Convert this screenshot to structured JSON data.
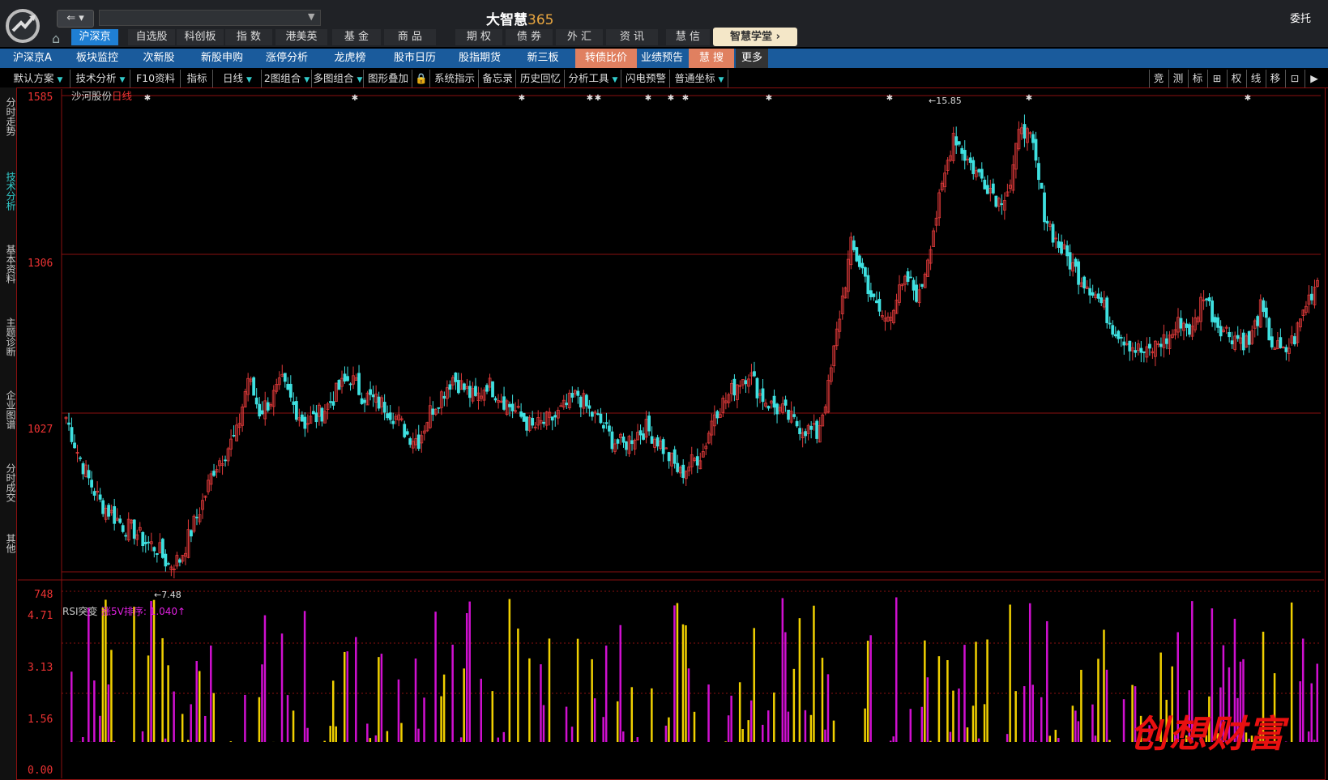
{
  "app": {
    "title_main": "大智慧",
    "title_num": "365",
    "back_label": "⇐ ▾",
    "entrust_label": "委托"
  },
  "top_nav": [
    {
      "label": "沪深京"
    },
    {
      "label": "自选股"
    },
    {
      "label": "科创板"
    },
    {
      "label": "指 数"
    },
    {
      "label": "港美英"
    },
    {
      "label": "基 金"
    },
    {
      "label": "商 品"
    },
    {
      "label": "期 权"
    },
    {
      "label": "债 券"
    },
    {
      "label": "外 汇"
    },
    {
      "label": "资 讯"
    },
    {
      "label": "慧 信"
    }
  ],
  "academy_label": "智慧学堂 ›",
  "nav2": [
    {
      "label": "沪深京A"
    },
    {
      "label": "板块监控"
    },
    {
      "label": "次新股"
    },
    {
      "label": "新股申购"
    },
    {
      "label": "涨停分析"
    },
    {
      "label": "龙虎榜"
    },
    {
      "label": "股市日历"
    },
    {
      "label": "股指期货"
    },
    {
      "label": "新三板"
    },
    {
      "label": "转债比价"
    },
    {
      "label": "业绩预告"
    },
    {
      "label": "慧 搜"
    },
    {
      "label": "更多"
    }
  ],
  "toolbar": [
    {
      "label": "默认方案"
    },
    {
      "label": "技术分析"
    },
    {
      "label": "F10资料"
    },
    {
      "label": "指标"
    },
    {
      "label": "日线"
    },
    {
      "label": "2图组合"
    },
    {
      "label": "多图组合"
    },
    {
      "label": "图形叠加"
    },
    {
      "label": "系统指示"
    },
    {
      "label": "备忘录"
    },
    {
      "label": "历史回忆"
    },
    {
      "label": "分析工具"
    },
    {
      "label": "闪电预警"
    },
    {
      "label": "普通坐标"
    }
  ],
  "toolbar_right": [
    "竞",
    "测",
    "标",
    "⊞",
    "权",
    "线",
    "移",
    "⊡",
    "▶"
  ],
  "sidebar": [
    {
      "label": "分时走势"
    },
    {
      "label": "技术分析"
    },
    {
      "label": "基本资料"
    },
    {
      "label": "主题诊断"
    },
    {
      "label": "企业图谱"
    },
    {
      "label": "分时成交"
    },
    {
      "label": "其他"
    }
  ],
  "stock": {
    "name": "沙河股份",
    "period": "日线"
  },
  "price_axis": {
    "labels": [
      "1585",
      "1306",
      "1027",
      "748"
    ]
  },
  "annotations": {
    "high": "←15.85",
    "low": "←7.48"
  },
  "rsi": {
    "title": "RSI突变",
    "subtitle": "涨5V排序: 1.040↑",
    "axis_labels": [
      "4.71",
      "3.13",
      "1.56",
      "0.00"
    ]
  },
  "watermark": "创想财富",
  "colors": {
    "up": "#e03a3a",
    "down": "#3ee0e0",
    "grid": "#8a1010",
    "bar_yellow": "#f0d000",
    "bar_magenta": "#d010d0"
  },
  "chart_data": {
    "type": "candlestick",
    "price_range": [
      7.48,
      15.85
    ],
    "closes": [
      10.2,
      9.6,
      9.1,
      8.7,
      8.5,
      8.3,
      8.2,
      8.0,
      7.9,
      7.6,
      7.7,
      8.2,
      8.7,
      9.3,
      9.6,
      9.9,
      10.9,
      10.3,
      10.5,
      10.8,
      10.4,
      10.1,
      10.2,
      10.4,
      10.7,
      10.9,
      10.6,
      10.5,
      10.4,
      10.2,
      9.9,
      9.8,
      10.3,
      10.6,
      10.9,
      10.7,
      10.5,
      10.8,
      10.6,
      10.4,
      10.2,
      10.0,
      10.1,
      10.2,
      10.4,
      10.6,
      10.3,
      10.1,
      9.8,
      9.7,
      9.9,
      10.0,
      9.8,
      9.5,
      9.2,
      9.4,
      9.6,
      10.3,
      10.5,
      10.8,
      11.0,
      10.6,
      10.4,
      10.3,
      10.1,
      10.0,
      9.9,
      10.7,
      12.0,
      13.2,
      12.8,
      12.2,
      11.9,
      12.3,
      12.6,
      12.3,
      13.3,
      14.2,
      15.2,
      14.8,
      14.5,
      14.3,
      14.0,
      14.3,
      15.4,
      14.9,
      13.8,
      13.3,
      13.0,
      12.7,
      12.5,
      12.2,
      11.8,
      11.6,
      11.4,
      11.3,
      11.5,
      11.6,
      11.9,
      11.7,
      12.4,
      11.9,
      11.7,
      11.6,
      11.5,
      12.1,
      11.5,
      11.3,
      11.6,
      12.2,
      12.6
    ]
  }
}
